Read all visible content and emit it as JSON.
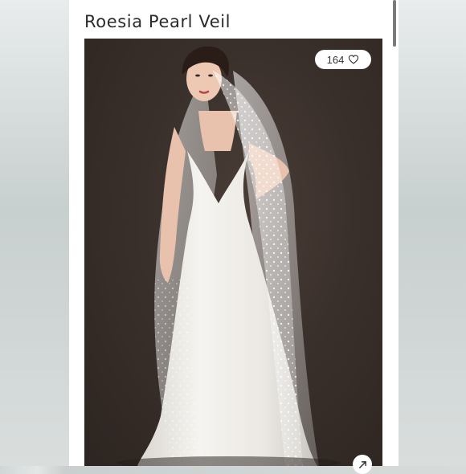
{
  "listing": {
    "title": "Roesia Pearl Veil",
    "like_count": "164"
  },
  "photo": {
    "subject": "model-in-white-gown-with-pearl-veil"
  },
  "icons": {
    "like": "heart-icon",
    "expand": "expand-arrow-icon"
  },
  "colors": {
    "backdrop": "#3a302b",
    "gown": "#f2f0ec",
    "accent_text": "#2b2b2b"
  }
}
